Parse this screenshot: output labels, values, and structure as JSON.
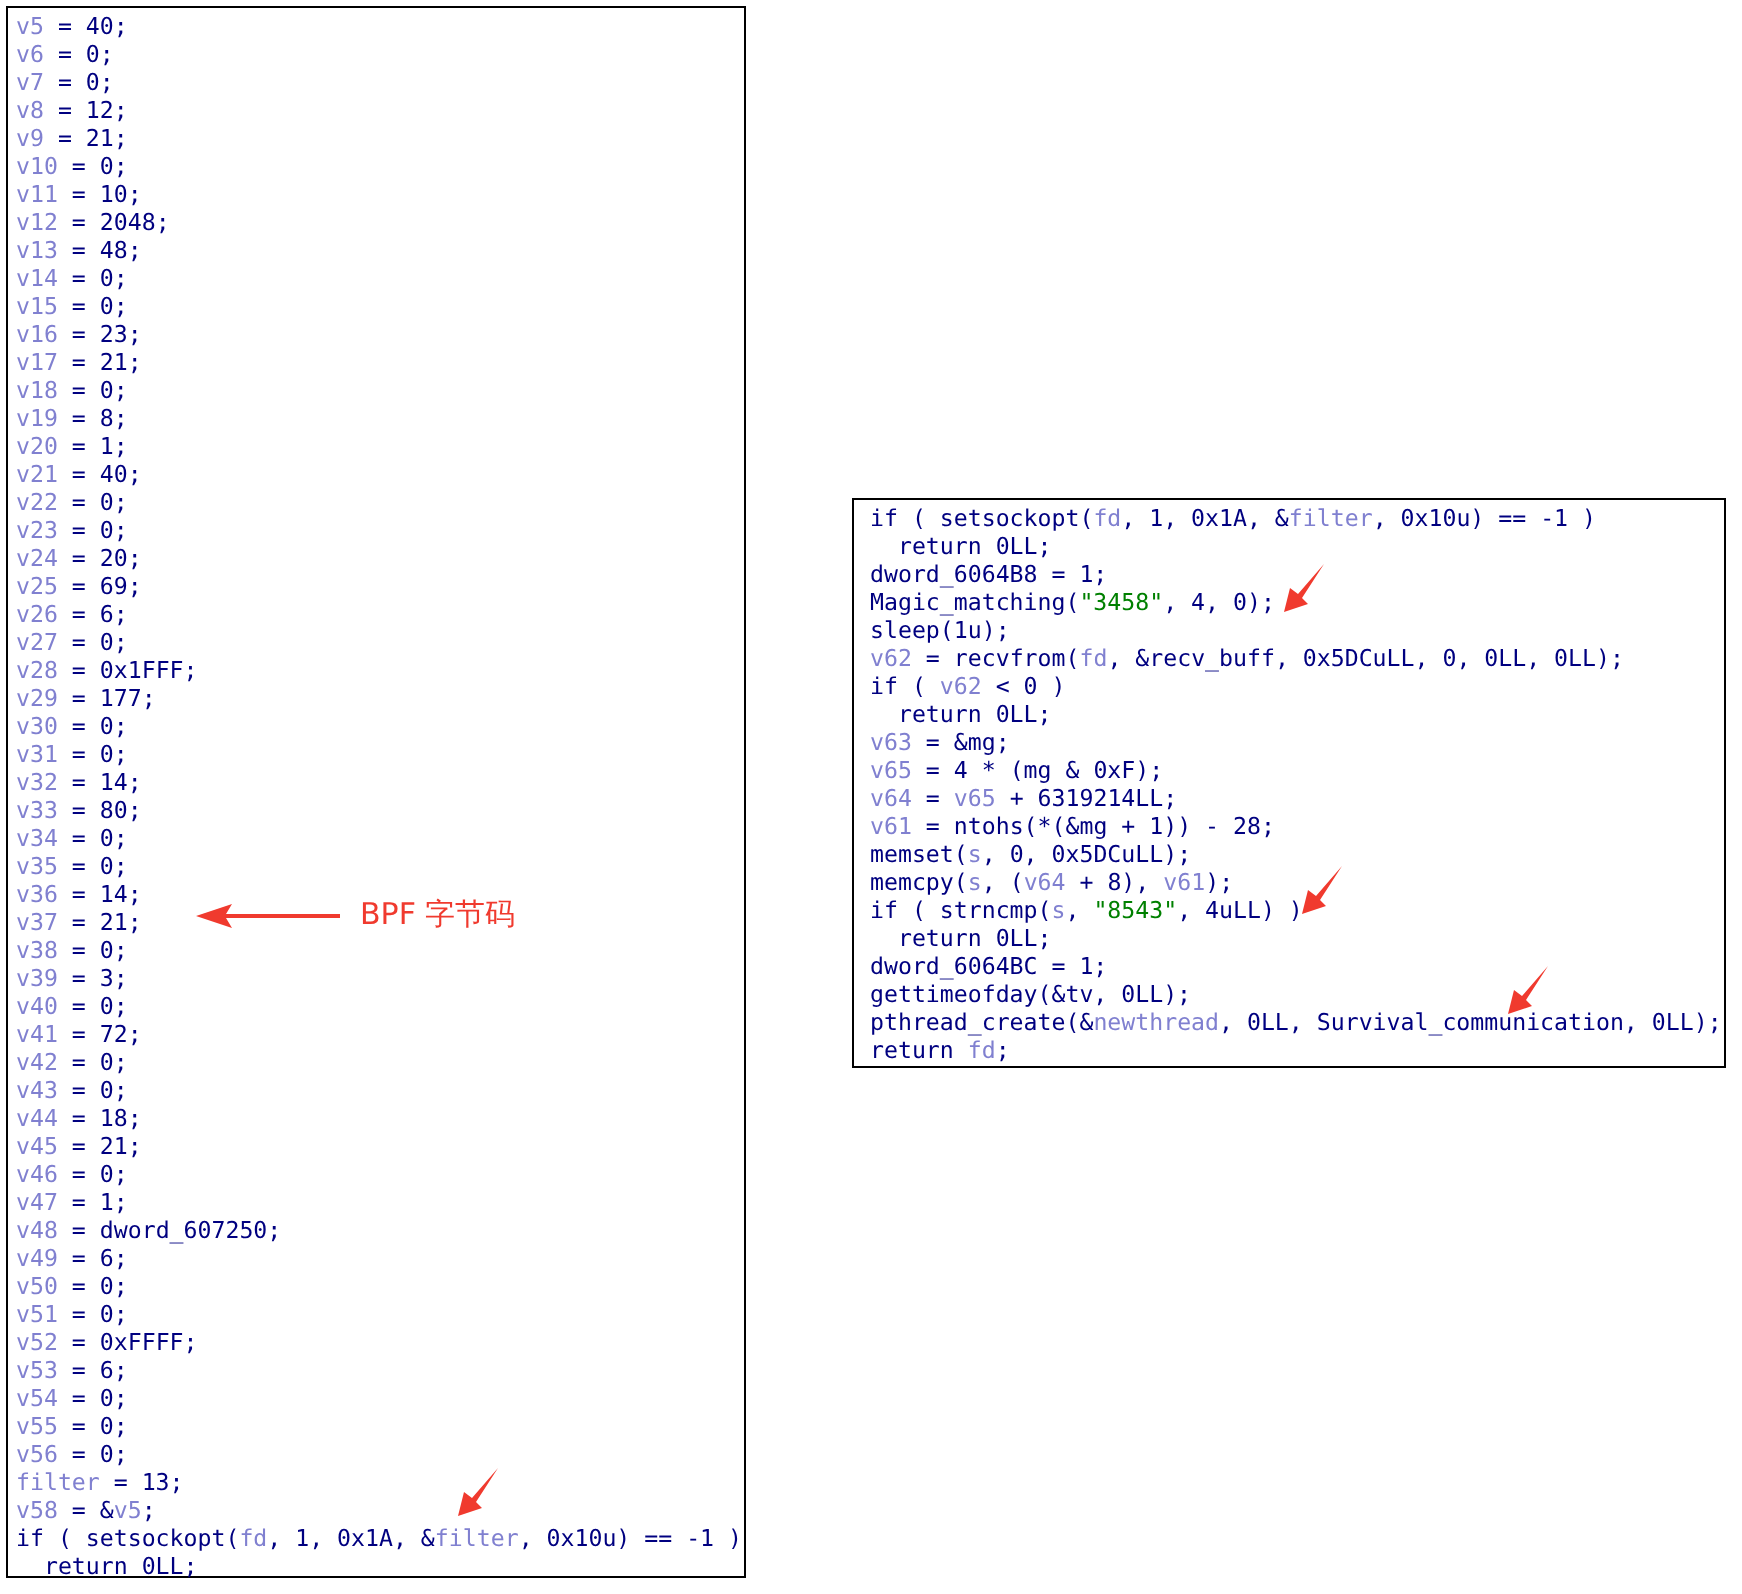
{
  "left_panel": {
    "lines": [
      [
        {
          "kind": "var",
          "text": "v5"
        },
        {
          "kind": "code",
          "text": " = 40;"
        }
      ],
      [
        {
          "kind": "var",
          "text": "v6"
        },
        {
          "kind": "code",
          "text": " = 0;"
        }
      ],
      [
        {
          "kind": "var",
          "text": "v7"
        },
        {
          "kind": "code",
          "text": " = 0;"
        }
      ],
      [
        {
          "kind": "var",
          "text": "v8"
        },
        {
          "kind": "code",
          "text": " = 12;"
        }
      ],
      [
        {
          "kind": "var",
          "text": "v9"
        },
        {
          "kind": "code",
          "text": " = 21;"
        }
      ],
      [
        {
          "kind": "var",
          "text": "v10"
        },
        {
          "kind": "code",
          "text": " = 0;"
        }
      ],
      [
        {
          "kind": "var",
          "text": "v11"
        },
        {
          "kind": "code",
          "text": " = 10;"
        }
      ],
      [
        {
          "kind": "var",
          "text": "v12"
        },
        {
          "kind": "code",
          "text": " = 2048;"
        }
      ],
      [
        {
          "kind": "var",
          "text": "v13"
        },
        {
          "kind": "code",
          "text": " = 48;"
        }
      ],
      [
        {
          "kind": "var",
          "text": "v14"
        },
        {
          "kind": "code",
          "text": " = 0;"
        }
      ],
      [
        {
          "kind": "var",
          "text": "v15"
        },
        {
          "kind": "code",
          "text": " = 0;"
        }
      ],
      [
        {
          "kind": "var",
          "text": "v16"
        },
        {
          "kind": "code",
          "text": " = 23;"
        }
      ],
      [
        {
          "kind": "var",
          "text": "v17"
        },
        {
          "kind": "code",
          "text": " = 21;"
        }
      ],
      [
        {
          "kind": "var",
          "text": "v18"
        },
        {
          "kind": "code",
          "text": " = 0;"
        }
      ],
      [
        {
          "kind": "var",
          "text": "v19"
        },
        {
          "kind": "code",
          "text": " = 8;"
        }
      ],
      [
        {
          "kind": "var",
          "text": "v20"
        },
        {
          "kind": "code",
          "text": " = 1;"
        }
      ],
      [
        {
          "kind": "var",
          "text": "v21"
        },
        {
          "kind": "code",
          "text": " = 40;"
        }
      ],
      [
        {
          "kind": "var",
          "text": "v22"
        },
        {
          "kind": "code",
          "text": " = 0;"
        }
      ],
      [
        {
          "kind": "var",
          "text": "v23"
        },
        {
          "kind": "code",
          "text": " = 0;"
        }
      ],
      [
        {
          "kind": "var",
          "text": "v24"
        },
        {
          "kind": "code",
          "text": " = 20;"
        }
      ],
      [
        {
          "kind": "var",
          "text": "v25"
        },
        {
          "kind": "code",
          "text": " = 69;"
        }
      ],
      [
        {
          "kind": "var",
          "text": "v26"
        },
        {
          "kind": "code",
          "text": " = 6;"
        }
      ],
      [
        {
          "kind": "var",
          "text": "v27"
        },
        {
          "kind": "code",
          "text": " = 0;"
        }
      ],
      [
        {
          "kind": "var",
          "text": "v28"
        },
        {
          "kind": "code",
          "text": " = 0x1FFF;"
        }
      ],
      [
        {
          "kind": "var",
          "text": "v29"
        },
        {
          "kind": "code",
          "text": " = 177;"
        }
      ],
      [
        {
          "kind": "var",
          "text": "v30"
        },
        {
          "kind": "code",
          "text": " = 0;"
        }
      ],
      [
        {
          "kind": "var",
          "text": "v31"
        },
        {
          "kind": "code",
          "text": " = 0;"
        }
      ],
      [
        {
          "kind": "var",
          "text": "v32"
        },
        {
          "kind": "code",
          "text": " = 14;"
        }
      ],
      [
        {
          "kind": "var",
          "text": "v33"
        },
        {
          "kind": "code",
          "text": " = 80;"
        }
      ],
      [
        {
          "kind": "var",
          "text": "v34"
        },
        {
          "kind": "code",
          "text": " = 0;"
        }
      ],
      [
        {
          "kind": "var",
          "text": "v35"
        },
        {
          "kind": "code",
          "text": " = 0;"
        }
      ],
      [
        {
          "kind": "var",
          "text": "v36"
        },
        {
          "kind": "code",
          "text": " = 14;"
        }
      ],
      [
        {
          "kind": "var",
          "text": "v37"
        },
        {
          "kind": "code",
          "text": " = 21;"
        }
      ],
      [
        {
          "kind": "var",
          "text": "v38"
        },
        {
          "kind": "code",
          "text": " = 0;"
        }
      ],
      [
        {
          "kind": "var",
          "text": "v39"
        },
        {
          "kind": "code",
          "text": " = 3;"
        }
      ],
      [
        {
          "kind": "var",
          "text": "v40"
        },
        {
          "kind": "code",
          "text": " = 0;"
        }
      ],
      [
        {
          "kind": "var",
          "text": "v41"
        },
        {
          "kind": "code",
          "text": " = 72;"
        }
      ],
      [
        {
          "kind": "var",
          "text": "v42"
        },
        {
          "kind": "code",
          "text": " = 0;"
        }
      ],
      [
        {
          "kind": "var",
          "text": "v43"
        },
        {
          "kind": "code",
          "text": " = 0;"
        }
      ],
      [
        {
          "kind": "var",
          "text": "v44"
        },
        {
          "kind": "code",
          "text": " = 18;"
        }
      ],
      [
        {
          "kind": "var",
          "text": "v45"
        },
        {
          "kind": "code",
          "text": " = 21;"
        }
      ],
      [
        {
          "kind": "var",
          "text": "v46"
        },
        {
          "kind": "code",
          "text": " = 0;"
        }
      ],
      [
        {
          "kind": "var",
          "text": "v47"
        },
        {
          "kind": "code",
          "text": " = 1;"
        }
      ],
      [
        {
          "kind": "var",
          "text": "v48"
        },
        {
          "kind": "code",
          "text": " = dword_607250;"
        }
      ],
      [
        {
          "kind": "var",
          "text": "v49"
        },
        {
          "kind": "code",
          "text": " = 6;"
        }
      ],
      [
        {
          "kind": "var",
          "text": "v50"
        },
        {
          "kind": "code",
          "text": " = 0;"
        }
      ],
      [
        {
          "kind": "var",
          "text": "v51"
        },
        {
          "kind": "code",
          "text": " = 0;"
        }
      ],
      [
        {
          "kind": "var",
          "text": "v52"
        },
        {
          "kind": "code",
          "text": " = 0xFFFF;"
        }
      ],
      [
        {
          "kind": "var",
          "text": "v53"
        },
        {
          "kind": "code",
          "text": " = 6;"
        }
      ],
      [
        {
          "kind": "var",
          "text": "v54"
        },
        {
          "kind": "code",
          "text": " = 0;"
        }
      ],
      [
        {
          "kind": "var",
          "text": "v55"
        },
        {
          "kind": "code",
          "text": " = 0;"
        }
      ],
      [
        {
          "kind": "var",
          "text": "v56"
        },
        {
          "kind": "code",
          "text": " = 0;"
        }
      ],
      [
        {
          "kind": "var",
          "text": "filter"
        },
        {
          "kind": "code",
          "text": " = 13;"
        }
      ],
      [
        {
          "kind": "var",
          "text": "v58"
        },
        {
          "kind": "code",
          "text": " = &"
        },
        {
          "kind": "var",
          "text": "v5"
        },
        {
          "kind": "code",
          "text": ";"
        }
      ],
      [
        {
          "kind": "code",
          "text": "if ( setsockopt("
        },
        {
          "kind": "var",
          "text": "fd"
        },
        {
          "kind": "code",
          "text": ", 1, 0x1A, &"
        },
        {
          "kind": "var",
          "text": "filter"
        },
        {
          "kind": "code",
          "text": ", 0x10u) == -1 )"
        }
      ],
      [
        {
          "kind": "code",
          "text": "  return 0LL;"
        }
      ]
    ]
  },
  "annotation": {
    "label": "BPF 字节码"
  },
  "right_panel": {
    "lines": [
      [
        {
          "kind": "code",
          "text": "if ( setsockopt("
        },
        {
          "kind": "var",
          "text": "fd"
        },
        {
          "kind": "code",
          "text": ", 1, 0x1A, &"
        },
        {
          "kind": "var",
          "text": "filter"
        },
        {
          "kind": "code",
          "text": ", 0x10u) == -1 )"
        }
      ],
      [
        {
          "kind": "code",
          "text": "  return 0LL;"
        }
      ],
      [
        {
          "kind": "code",
          "text": "dword_6064B8 = 1;"
        }
      ],
      [
        {
          "kind": "code",
          "text": "Magic_matching("
        },
        {
          "kind": "str",
          "text": "\"3458\""
        },
        {
          "kind": "code",
          "text": ", 4, 0);"
        }
      ],
      [
        {
          "kind": "code",
          "text": "sleep(1u);"
        }
      ],
      [
        {
          "kind": "var",
          "text": "v62"
        },
        {
          "kind": "code",
          "text": " = recvfrom("
        },
        {
          "kind": "var",
          "text": "fd"
        },
        {
          "kind": "code",
          "text": ", &recv_buff, 0x5DCuLL, 0, 0LL, 0LL);"
        }
      ],
      [
        {
          "kind": "code",
          "text": "if ( "
        },
        {
          "kind": "var",
          "text": "v62"
        },
        {
          "kind": "code",
          "text": " < 0 )"
        }
      ],
      [
        {
          "kind": "code",
          "text": "  return 0LL;"
        }
      ],
      [
        {
          "kind": "var",
          "text": "v63"
        },
        {
          "kind": "code",
          "text": " = &mg;"
        }
      ],
      [
        {
          "kind": "var",
          "text": "v65"
        },
        {
          "kind": "code",
          "text": " = 4 * (mg & 0xF);"
        }
      ],
      [
        {
          "kind": "var",
          "text": "v64"
        },
        {
          "kind": "code",
          "text": " = "
        },
        {
          "kind": "var",
          "text": "v65"
        },
        {
          "kind": "code",
          "text": " + 6319214LL;"
        }
      ],
      [
        {
          "kind": "var",
          "text": "v61"
        },
        {
          "kind": "code",
          "text": " = ntohs(*(&mg + 1)) - 28;"
        }
      ],
      [
        {
          "kind": "code",
          "text": "memset("
        },
        {
          "kind": "var",
          "text": "s"
        },
        {
          "kind": "code",
          "text": ", 0, 0x5DCuLL);"
        }
      ],
      [
        {
          "kind": "code",
          "text": "memcpy("
        },
        {
          "kind": "var",
          "text": "s"
        },
        {
          "kind": "code",
          "text": ", ("
        },
        {
          "kind": "var",
          "text": "v64"
        },
        {
          "kind": "code",
          "text": " + 8), "
        },
        {
          "kind": "var",
          "text": "v61"
        },
        {
          "kind": "code",
          "text": ");"
        }
      ],
      [
        {
          "kind": "code",
          "text": "if ( strncmp("
        },
        {
          "kind": "var",
          "text": "s"
        },
        {
          "kind": "code",
          "text": ", "
        },
        {
          "kind": "str",
          "text": "\"8543\""
        },
        {
          "kind": "code",
          "text": ", 4uLL) )"
        }
      ],
      [
        {
          "kind": "code",
          "text": "  return 0LL;"
        }
      ],
      [
        {
          "kind": "code",
          "text": "dword_6064BC = 1;"
        }
      ],
      [
        {
          "kind": "code",
          "text": "gettimeofday(&tv, 0LL);"
        }
      ],
      [
        {
          "kind": "code",
          "text": "pthread_create(&"
        },
        {
          "kind": "var",
          "text": "newthread"
        },
        {
          "kind": "code",
          "text": ", 0LL, Survival_communication, 0LL);"
        }
      ],
      [
        {
          "kind": "code",
          "text": "return "
        },
        {
          "kind": "var",
          "text": "fd"
        },
        {
          "kind": "code",
          "text": ";"
        }
      ]
    ]
  }
}
